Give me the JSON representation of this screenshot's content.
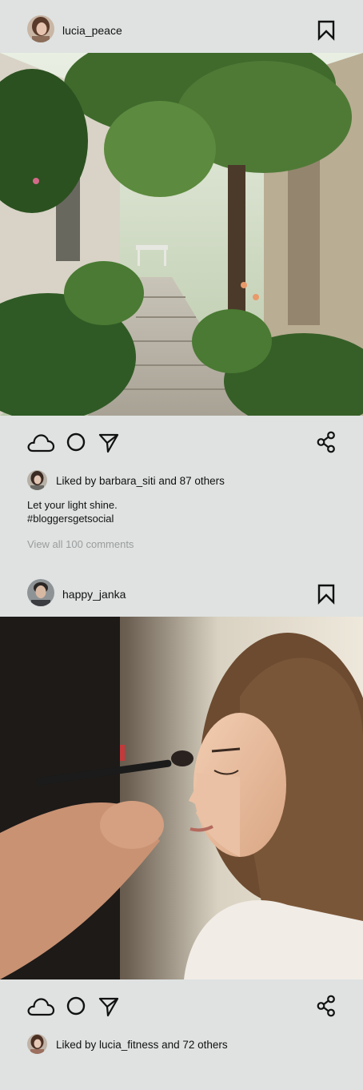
{
  "posts": [
    {
      "username": "lucia_peace",
      "avatar": "woman-portrait-avatar",
      "photo": "garden-courtyard-path",
      "liked_by_text": "Liked by barbara_siti and 87 others",
      "caption": [
        "Let your light shine.",
        "#bloggersgetsocial"
      ],
      "comments_link": "View all 100 comments"
    },
    {
      "username": "happy_janka",
      "avatar": "man-portrait-avatar",
      "photo": "makeup-brush-application",
      "liked_by_text": "Liked by lucia_fitness and 72 others"
    }
  ],
  "icons": {
    "like": "cloud-icon",
    "comment": "circle-icon",
    "share": "send-icon",
    "network_share": "share-nodes-icon",
    "save": "bookmark-icon"
  },
  "colors": {
    "background": "#dfe2e1",
    "text": "#111111",
    "muted": "#9a9d9d"
  }
}
